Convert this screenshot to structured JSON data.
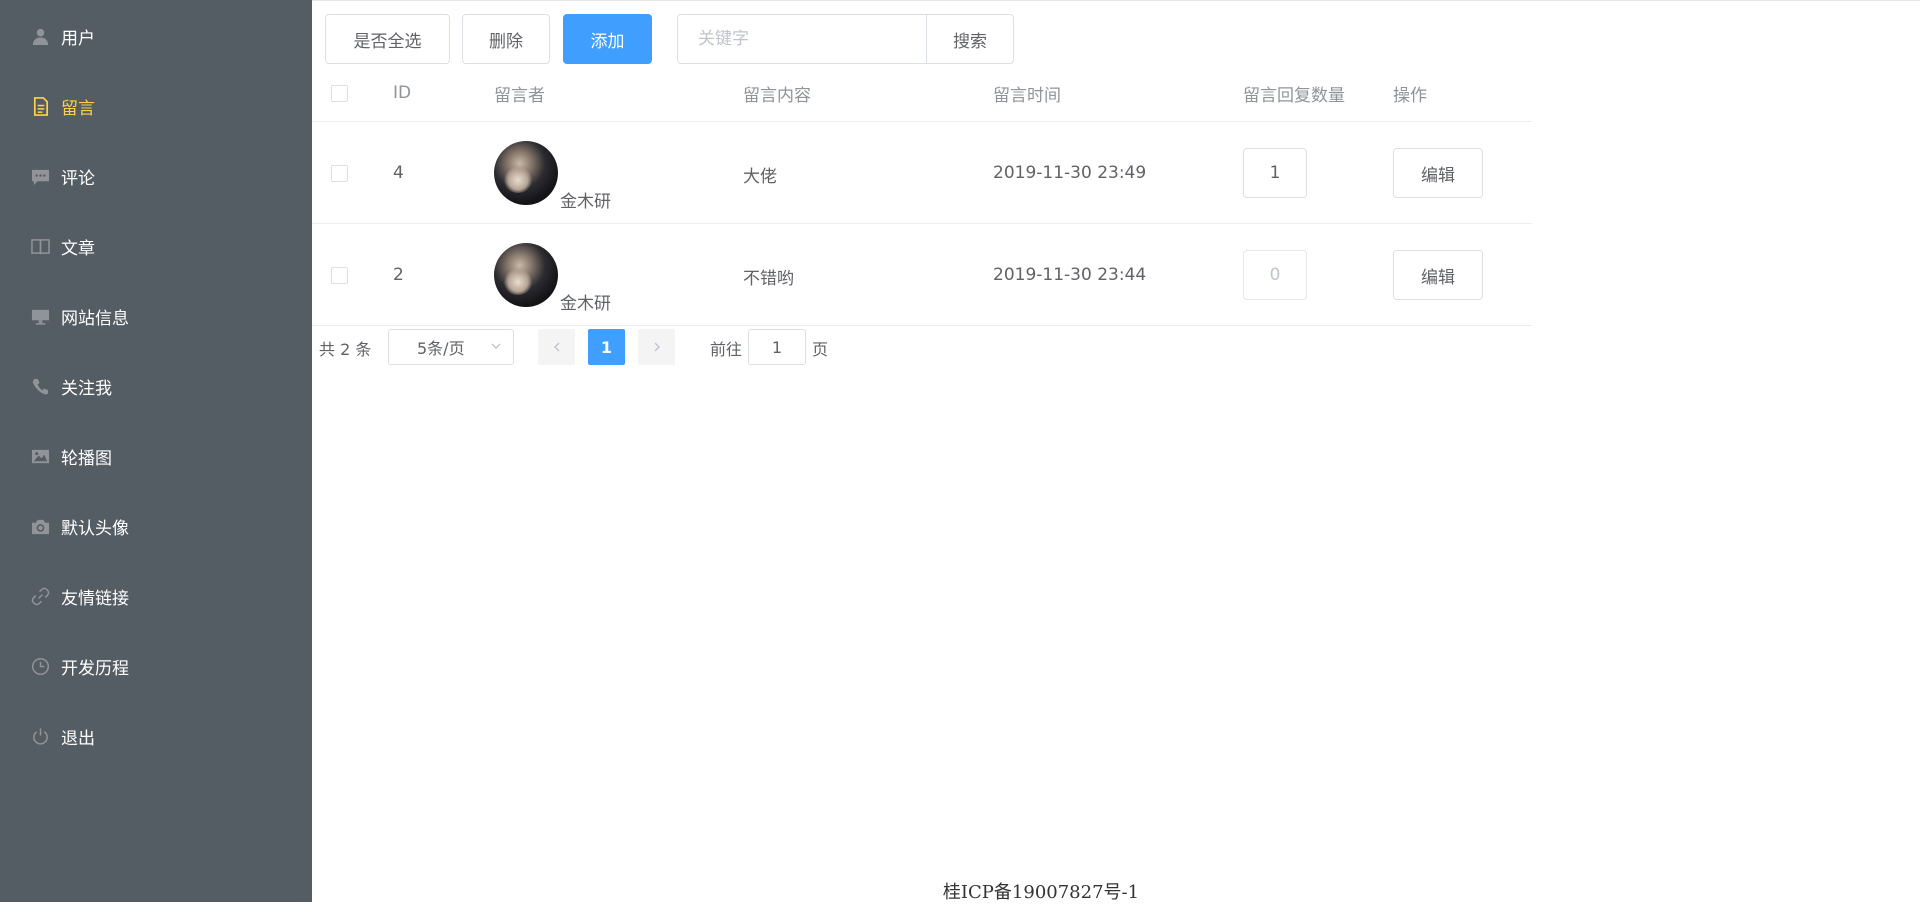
{
  "sidebar": {
    "bg_color": "#545c64",
    "active_color": "#ffd04b",
    "items": [
      {
        "label": "用户",
        "icon": "user-icon",
        "active": false
      },
      {
        "label": "留言",
        "icon": "document-icon",
        "active": true
      },
      {
        "label": "评论",
        "icon": "chat-icon",
        "active": false
      },
      {
        "label": "文章",
        "icon": "book-icon",
        "active": false
      },
      {
        "label": "网站信息",
        "icon": "monitor-icon",
        "active": false
      },
      {
        "label": "关注我",
        "icon": "phone-icon",
        "active": false
      },
      {
        "label": "轮播图",
        "icon": "picture-icon",
        "active": false
      },
      {
        "label": "默认头像",
        "icon": "camera-icon",
        "active": false
      },
      {
        "label": "友情链接",
        "icon": "link-icon",
        "active": false
      },
      {
        "label": "开发历程",
        "icon": "clock-icon",
        "active": false
      },
      {
        "label": "退出",
        "icon": "power-icon",
        "active": false
      }
    ]
  },
  "toolbar": {
    "select_all_label": "是否全选",
    "delete_label": "删除",
    "add_label": "添加",
    "search_placeholder": "关键字",
    "search_value": "",
    "search_label": "搜索",
    "primary_color": "#409eff"
  },
  "table": {
    "headers": {
      "id": "ID",
      "author": "留言者",
      "content": "留言内容",
      "time": "留言时间",
      "reply_count": "留言回复数量",
      "actions": "操作"
    },
    "rows": [
      {
        "id": "4",
        "author": "金木研",
        "content": "大佬",
        "time": "2019-11-30 23:49",
        "reply_count": "1",
        "edit_label": "编辑"
      },
      {
        "id": "2",
        "author": "金木研",
        "content": "不错哟",
        "time": "2019-11-30 23:44",
        "reply_count": "0",
        "edit_label": "编辑"
      }
    ]
  },
  "pagination": {
    "total_text": "共 2 条",
    "page_size": "5条/页",
    "current_page": "1",
    "goto_label": "前往",
    "goto_value": "1",
    "page_suffix": "页"
  },
  "footer": {
    "icp": "桂ICP备19007827号-1"
  }
}
